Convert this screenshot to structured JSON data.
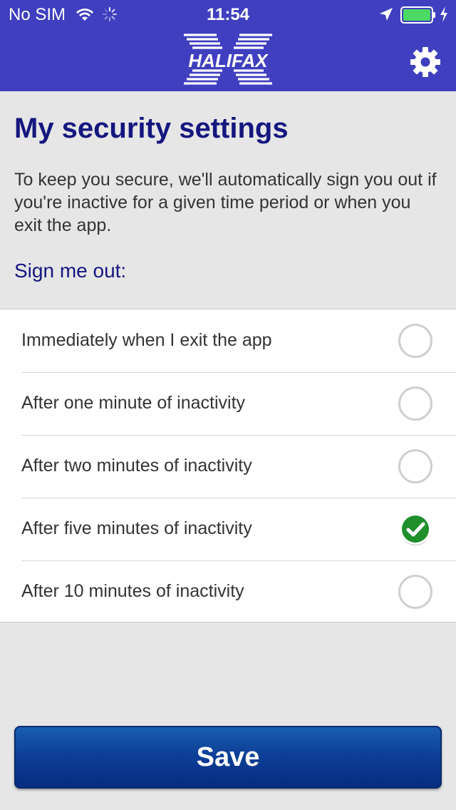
{
  "status_bar": {
    "carrier": "No SIM",
    "time": "11:54",
    "battery_level": 1.0
  },
  "header": {
    "logo_text": "HALIFAX"
  },
  "page": {
    "title": "My security settings",
    "intro": "To keep you secure, we'll automatically sign you out if you're inactive for a given time period or when you exit the app.",
    "section_label": "Sign me out:"
  },
  "options": [
    {
      "label": "Immediately when I exit the app",
      "selected": false
    },
    {
      "label": "After one minute of inactivity",
      "selected": false
    },
    {
      "label": "After two minutes of inactivity",
      "selected": false
    },
    {
      "label": "After five minutes of inactivity",
      "selected": true
    },
    {
      "label": "After 10 minutes of inactivity",
      "selected": false
    }
  ],
  "save_button": {
    "label": "Save"
  },
  "colors": {
    "header_bg": "#3f3fc0",
    "title_color": "#15177f",
    "check_green": "#1f8f2c",
    "button_blue": "#0d3f97"
  },
  "icons": [
    "wifi-icon",
    "spinner-icon",
    "location-icon",
    "battery-icon",
    "charge-icon",
    "gear-icon",
    "checkmark-icon"
  ]
}
